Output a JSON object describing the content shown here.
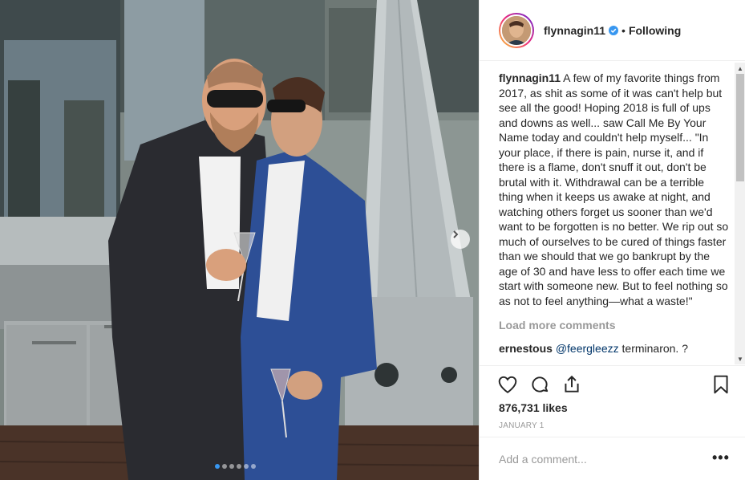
{
  "post": {
    "username": "flynnagin11",
    "verified": true,
    "follow_status": "Following",
    "separator": "•"
  },
  "caption": {
    "username": "flynnagin11",
    "text": "A few of my favorite things from 2017, as shit as some of it was can't help but see all the good! Hoping 2018 is full of ups and downs as well... saw Call Me By Your Name today and couldn't help myself... \"In your place, if there is pain, nurse it, and if there is a flame, don't snuff it out, don't be brutal with it. Withdrawal can be a terrible thing when it keeps us awake at night, and watching others forget us sooner than we'd want to be forgotten is no better. We rip out so much of ourselves to be cured of things faster than we should that we go bankrupt by the age of 30 and have less to offer each time we start with someone new. But to feel nothing so as not to feel anything—what a waste!\""
  },
  "load_more_label": "Load more comments",
  "comments": [
    {
      "username": "ernestous",
      "mention": "@feergleezz",
      "text": " terminaron. ?"
    }
  ],
  "likes": "876,731 likes",
  "date": "JANUARY 1",
  "add_comment": {
    "placeholder": "Add a comment..."
  },
  "more_options_label": "•••",
  "icons": {
    "like": "heart-icon",
    "comment": "comment-icon",
    "share": "share-icon",
    "save": "bookmark-icon",
    "next": "chevron-right-icon",
    "verified": "verified-badge-icon"
  },
  "carousel": {
    "count": 6,
    "active_index": 0
  },
  "colors": {
    "link": "#003569",
    "verified": "#3897f0",
    "muted": "#999999",
    "text": "#262626"
  }
}
